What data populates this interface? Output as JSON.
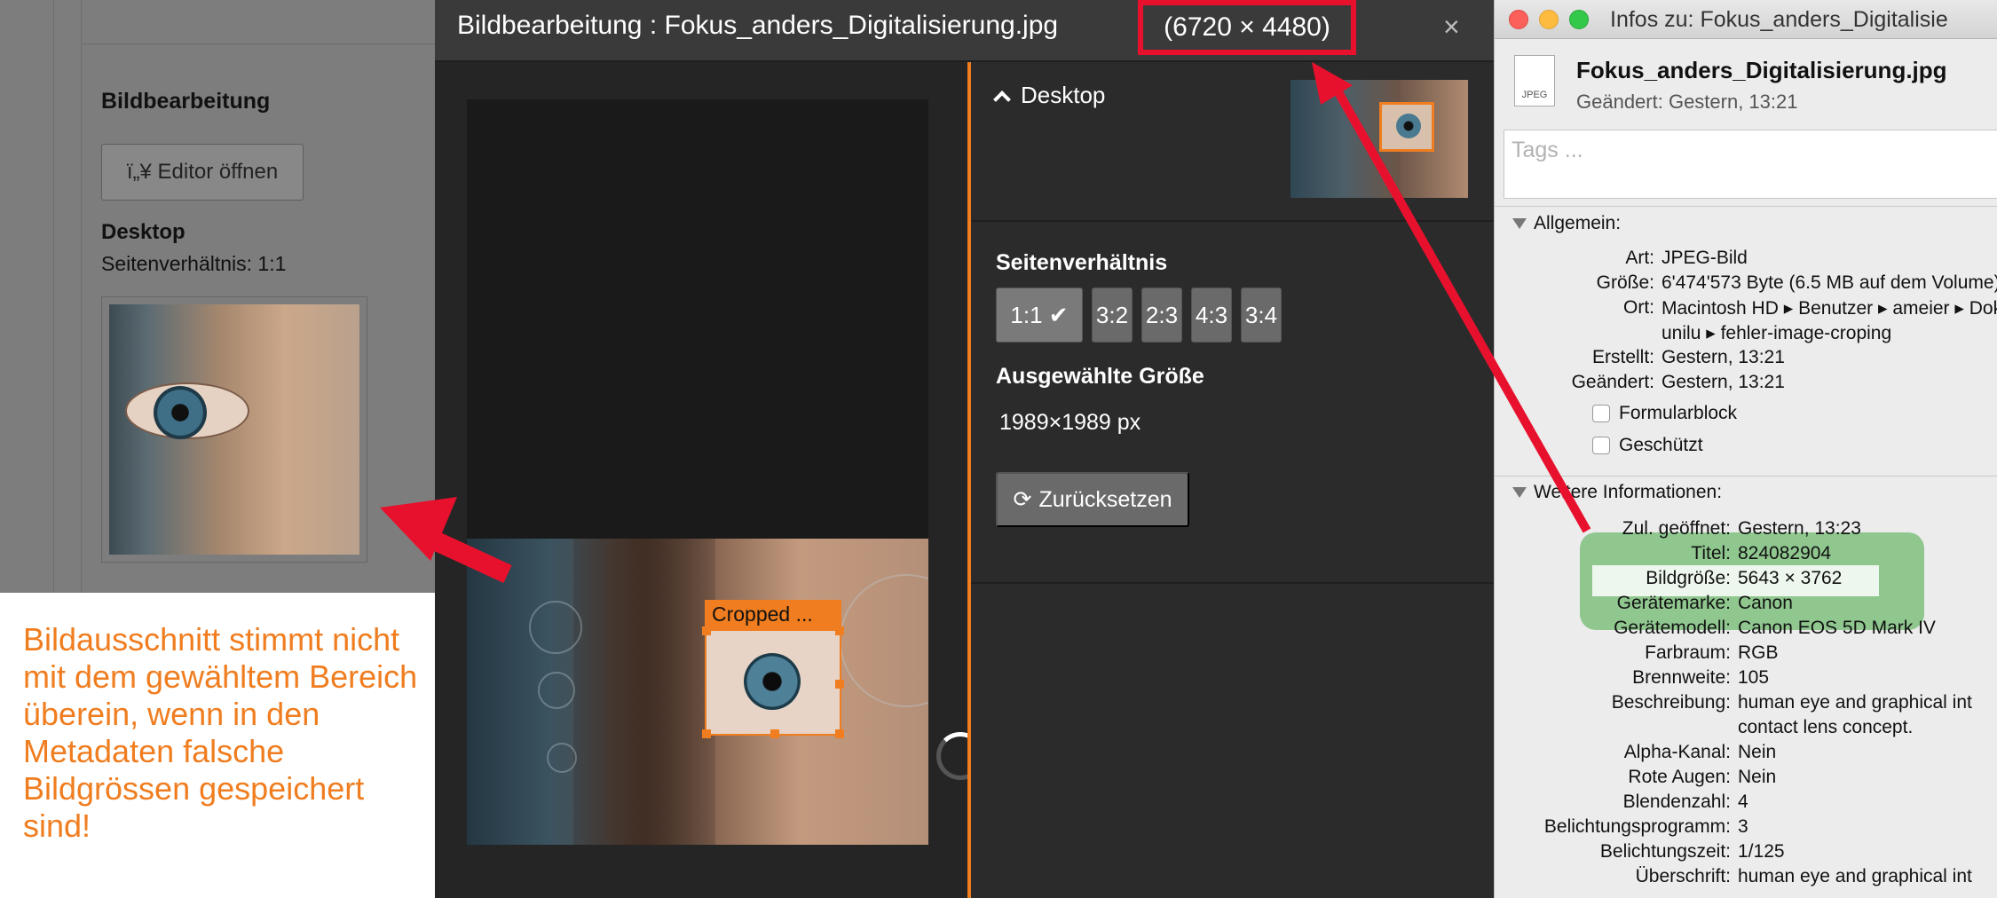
{
  "left_panel": {
    "title": "Bildbearbeitung",
    "editor_button": {
      "icon": "broken-glyph",
      "label": "ï„¥ Editor öffnen"
    },
    "desktop_label": "Desktop",
    "ratio_text": "Seitenverhältnis: 1:1"
  },
  "annotation": "Bildausschnitt stimmt nicht mit dem gewähltem Bereich überein, wenn in den Metadaten falsche Bildgrössen gespeichert sind!",
  "editor": {
    "title": "Bildbearbeitung : Fokus_anders_Digitalisierung.jpg",
    "dimensions": "(6720 × 4480)",
    "close": "×",
    "crop_label": "Cropped ...",
    "desktop_section": "Desktop",
    "ratio_label": "Seitenverhältnis",
    "ratio_buttons": [
      {
        "label": "1:1 ✔",
        "active": true
      },
      {
        "label": "3:2",
        "active": false
      },
      {
        "label": "2:3",
        "active": false
      },
      {
        "label": "4:3",
        "active": false
      },
      {
        "label": "3:4",
        "active": false
      }
    ],
    "size_label": "Ausgewählte Größe",
    "size_value": "1989×1989 px",
    "reset_label": "Zurücksetzen",
    "accent_color": "#f07d1f"
  },
  "info_window": {
    "title": "Infos zu: Fokus_anders_Digitalisie",
    "doc_icon_label": "JPEG",
    "file_name": "Fokus_anders_Digitalisierung.jpg",
    "modified": "Geändert: Gestern, 13:21",
    "tags_placeholder": "Tags ...",
    "general_header": "Allgemein:",
    "general": [
      {
        "k": "Art:",
        "v": "JPEG-Bild"
      },
      {
        "k": "Größe:",
        "v": "6'474'573 Byte (6.5 MB auf dem Volume)"
      },
      {
        "k": "Ort:",
        "v": "Macintosh HD ▸ Benutzer ▸ ameier ▸ Dok"
      },
      {
        "k": "",
        "v": "unilu ▸ fehler-image-croping"
      },
      {
        "k": "Erstellt:",
        "v": "Gestern, 13:21"
      },
      {
        "k": "Geändert:",
        "v": "Gestern, 13:21"
      }
    ],
    "checkboxes": [
      "Formularblock",
      "Geschützt"
    ],
    "more_header": "Weitere Informationen:",
    "more": [
      {
        "k": "Zul. geöffnet:",
        "v": "Gestern, 13:23"
      },
      {
        "k": "Titel:",
        "v": "824082904"
      },
      {
        "k": "Bildgröße:",
        "v": "5643 × 3762"
      },
      {
        "k": "Gerätemarke:",
        "v": "Canon"
      },
      {
        "k": "Gerätemodell:",
        "v": "Canon EOS 5D Mark IV"
      },
      {
        "k": "Farbraum:",
        "v": "RGB"
      },
      {
        "k": "Brennweite:",
        "v": "105"
      },
      {
        "k": "Beschreibung:",
        "v": "human eye and graphical int"
      },
      {
        "k": "",
        "v": "contact lens concept."
      },
      {
        "k": "Alpha-Kanal:",
        "v": "Nein"
      },
      {
        "k": "Rote Augen:",
        "v": "Nein"
      },
      {
        "k": "Blendenzahl:",
        "v": "4"
      },
      {
        "k": "Belichtungsprogramm:",
        "v": "3"
      },
      {
        "k": "Belichtungszeit:",
        "v": "1/125"
      },
      {
        "k": "Überschrift:",
        "v": "human eye and graphical int"
      }
    ]
  },
  "highlight_colors": {
    "red": "#e8112d",
    "green": "#56b056"
  }
}
